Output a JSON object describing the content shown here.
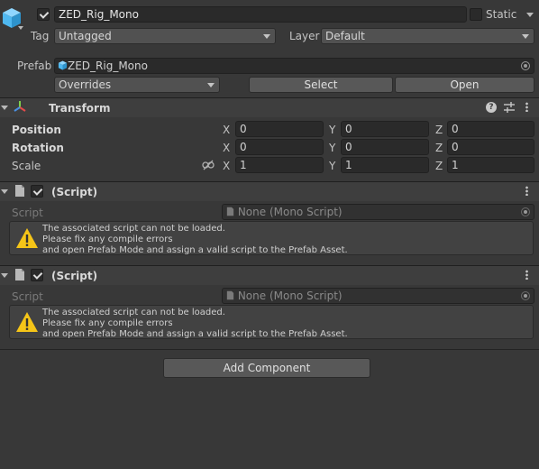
{
  "object": {
    "name": "ZED_Rig_Mono",
    "active": true,
    "static_label": "Static",
    "static_checked": false
  },
  "tag": {
    "label": "Tag",
    "value": "Untagged"
  },
  "layer": {
    "label": "Layer",
    "value": "Default"
  },
  "prefab": {
    "label": "Prefab",
    "asset": "ZED_Rig_Mono",
    "overrides": "Overrides",
    "select": "Select",
    "open": "Open"
  },
  "transform": {
    "title": "Transform",
    "position": {
      "label": "Position",
      "x": "0",
      "y": "0",
      "z": "0"
    },
    "rotation": {
      "label": "Rotation",
      "x": "0",
      "y": "0",
      "z": "0"
    },
    "scale": {
      "label": "Scale",
      "x": "1",
      "y": "1",
      "z": "1"
    },
    "axis_x": "X",
    "axis_y": "Y",
    "axis_z": "Z"
  },
  "scripts": [
    {
      "title": "(Script)",
      "field_label": "Script",
      "field_value": "None (Mono Script)",
      "enabled": true,
      "warning": [
        "The associated script can not be loaded.",
        "Please fix any compile errors",
        "and open Prefab Mode and assign a valid script to the Prefab Asset."
      ]
    },
    {
      "title": "(Script)",
      "field_label": "Script",
      "field_value": "None (Mono Script)",
      "enabled": true,
      "warning": [
        "The associated script can not be loaded.",
        "Please fix any compile errors",
        "and open Prefab Mode and assign a valid script to the Prefab Asset."
      ]
    }
  ],
  "add_component": "Add Component",
  "icons": {
    "object": "cube-icon",
    "transform": "transform-axes-icon",
    "script": "file-icon",
    "warning": "warning-triangle-icon",
    "help": "help-icon",
    "presets": "sliders-icon",
    "menu": "kebab-menu-icon",
    "link": "unlinked-scale-icon"
  },
  "colors": {
    "background": "#383838",
    "field": "#2a2a2a",
    "warning": "#f5c518",
    "cube": "#4fb8f0"
  }
}
